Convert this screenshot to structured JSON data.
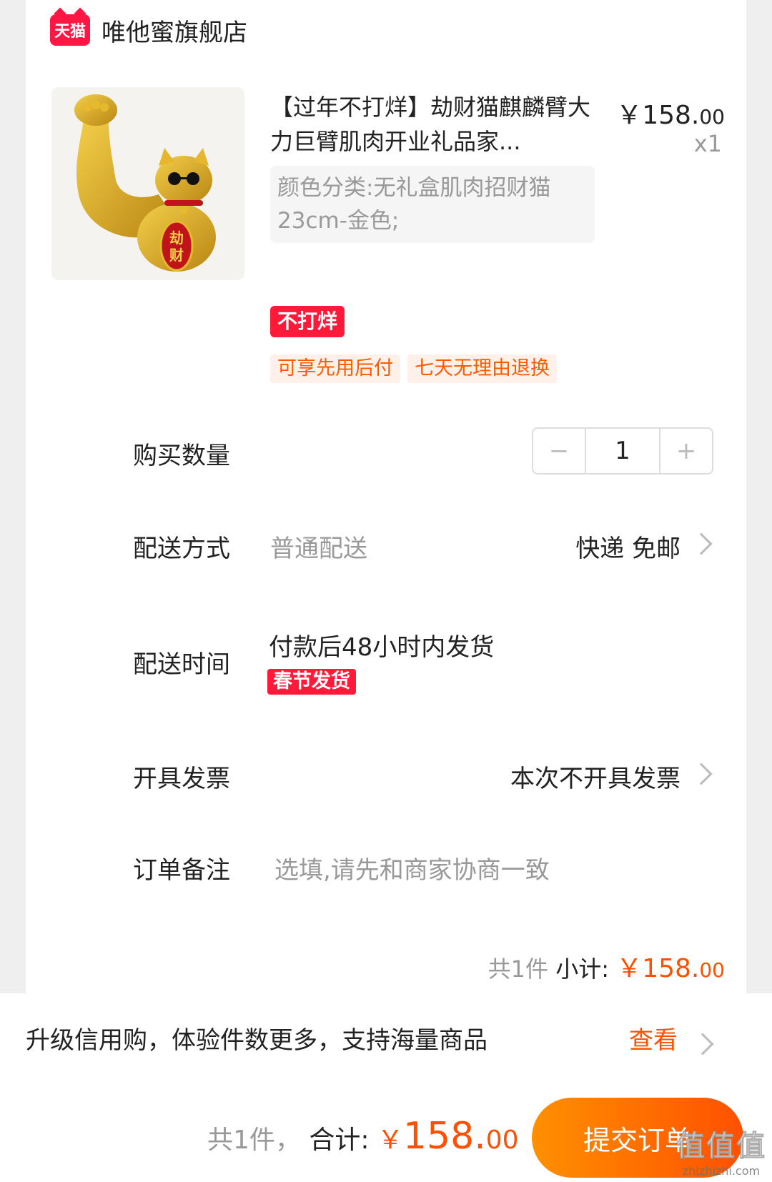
{
  "store": {
    "badge_label": "天猫",
    "name": "唯他蜜旗舰店"
  },
  "product": {
    "title": "【过年不打烊】劫财猫麒麟臂大力巨臂肌肉开业礼品家...",
    "price_symbol": "￥",
    "price_int": "158.",
    "price_dec": "00",
    "quantity_label": "x1",
    "sku": "颜色分类:无礼盒肌肉招财猫23cm-金色;",
    "image_text": "劫财",
    "promo_tag": "不打烊",
    "service_tags": [
      "可享先用后付",
      "七天无理由退换"
    ]
  },
  "quantity": {
    "label": "购买数量",
    "minus": "−",
    "value": "1",
    "plus": "+"
  },
  "delivery": {
    "label": "配送方式",
    "method": "普通配送",
    "value": "快递 免邮"
  },
  "ship_time": {
    "label": "配送时间",
    "value": "付款后48小时内发货",
    "tag": "春节发货"
  },
  "invoice": {
    "label": "开具发票",
    "value": "本次不开具发票"
  },
  "note": {
    "label": "订单备注",
    "placeholder": "选填,请先和商家协商一致"
  },
  "subtotal": {
    "count": "共1件",
    "label": "小计:",
    "symbol": "￥",
    "int": "158.",
    "dec": "00"
  },
  "credit": {
    "text": "升级信用购，体验件数更多，支持海量商品",
    "link": "查看"
  },
  "footer": {
    "count": "共1件，",
    "label": "合计:",
    "symbol": "￥",
    "int": "158.",
    "dec": "00",
    "submit": "提交订单",
    "watermark_main": "值值值",
    "watermark_sub": "zhizhizhi.com"
  },
  "colors": {
    "accent": "#ff5000",
    "tmall_red": "#ff1744",
    "promo_red": "#ff1a3a",
    "gold": "#d9a521"
  }
}
